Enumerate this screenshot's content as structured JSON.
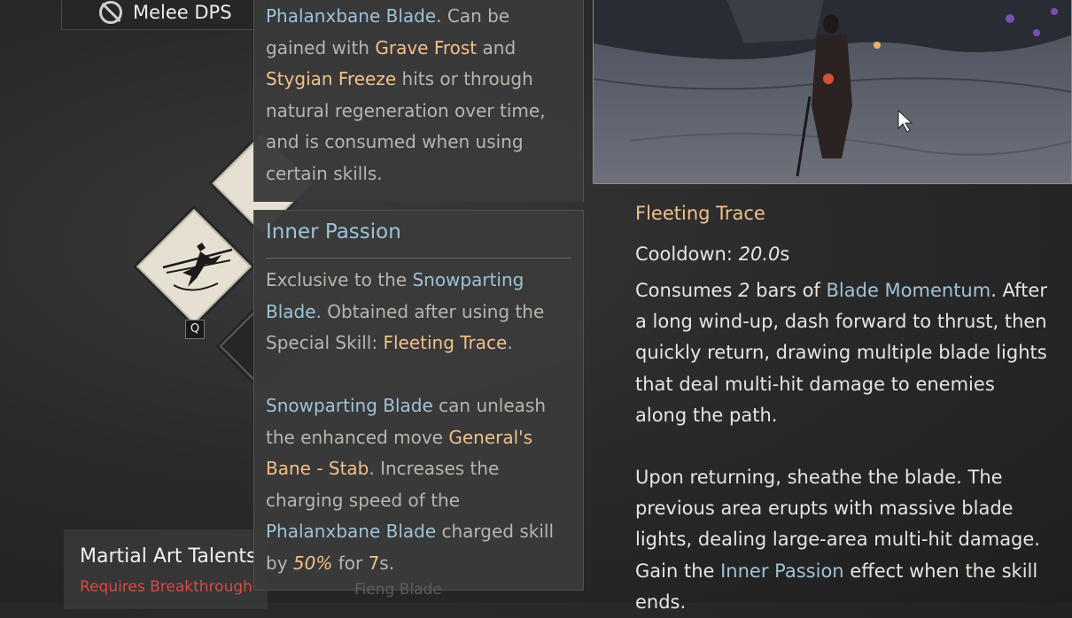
{
  "role": {
    "label": "Melee DPS",
    "icon": "no-entry-icon"
  },
  "skill_icons": {
    "key": "Q"
  },
  "talent": {
    "title": "Martial Art Talents",
    "requirement": "Requires Breakthrough"
  },
  "tooltip_upper": {
    "blade": "Phalanxbane Blade",
    "t1": ". Can be gained with ",
    "frost": "Grave Frost",
    "t2": " and ",
    "freeze": "Stygian Freeze",
    "t3": " hits or through natural regeneration over time, and is consumed when using certain skills."
  },
  "tooltip_lower": {
    "title": "Inner Passion",
    "p1_a": "Exclusive to the ",
    "p1_blade": "Snowparting Blade",
    "p1_b": ". Obtained after using the Special Skill: ",
    "p1_skill": "Fleeting Trace",
    "p1_c": ".",
    "p2_blade": "Snowparting Blade",
    "p2_a": " can unleash the enhanced move ",
    "p2_move": "General's Bane - Stab",
    "p2_b": ". Increases the charging speed of the ",
    "p2_blade2": "Phalanxbane Blade",
    "p2_c": " charged skill by ",
    "p2_pct": "50%",
    "p2_d": " for ",
    "p2_time": "7",
    "p2_e": "s.",
    "ghost": "Fieng Blade"
  },
  "skill_detail": {
    "name": "Fleeting Trace",
    "cooldown_label": "Cooldown: ",
    "cooldown_value": "20.0",
    "cooldown_unit": "s",
    "p1_a": "Consumes ",
    "p1_num": "2",
    "p1_b": " bars of ",
    "p1_term": "Blade Momentum",
    "p1_c": ". After a long wind-up, dash forward to thrust, then quickly return, drawing multiple blade lights that deal multi-hit damage to enemies along the path.",
    "p2_a": "Upon returning, sheathe the blade. The previous area erupts with massive blade lights, dealing large-area multi-hit damage.  Gain the ",
    "p2_term": "Inner Passion",
    "p2_b": " effect when the skill ends."
  },
  "colors": {
    "highlight_blue": "#9fc3d6",
    "highlight_orange": "#f3c088",
    "requirement_red": "#d44c44"
  }
}
